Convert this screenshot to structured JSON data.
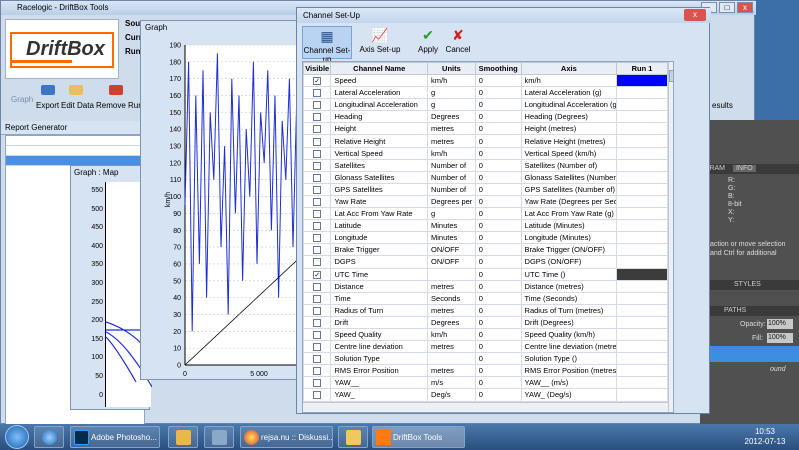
{
  "main_window": {
    "title": "Racelogic - DriftBox Tools",
    "controls": [
      "_",
      "□",
      "x"
    ],
    "logo_text": "DriftBox",
    "ribbon": {
      "graph_label": "Graph",
      "buttons": [
        "Export",
        "Edit Data",
        "Remove Run"
      ]
    },
    "side_labels": [
      "Sour",
      "Curr",
      "Run"
    ],
    "results_label": "esults",
    "report_generator": "Report Generator"
  },
  "map_window": {
    "title": "Graph : Map",
    "y_ticks": [
      "550",
      "500",
      "450",
      "400",
      "350",
      "300",
      "250",
      "200",
      "150",
      "100",
      "50",
      "0"
    ]
  },
  "graph_window": {
    "title": "Graph",
    "y_label": "km/h",
    "x_ticks": [
      "0",
      "5 000"
    ]
  },
  "chart_data": {
    "type": "line",
    "ylabel": "km/h",
    "ylim": [
      0,
      190
    ],
    "y_ticks": [
      0,
      10,
      20,
      30,
      40,
      50,
      60,
      70,
      80,
      90,
      100,
      110,
      120,
      130,
      140,
      150,
      160,
      170,
      180,
      190
    ],
    "x_ticks": [
      0,
      5000
    ],
    "grid": true,
    "series": [
      {
        "color": "#1f2fd6",
        "values": [
          95,
          180,
          20,
          160,
          60,
          175,
          40,
          150,
          110,
          185,
          70,
          130,
          30,
          170,
          90,
          160,
          50,
          140,
          100,
          180,
          60,
          150,
          120,
          175,
          80,
          160,
          40,
          145,
          110,
          170,
          70,
          155,
          95,
          165,
          55,
          140
        ]
      },
      {
        "color": "#111111",
        "values": [
          0,
          2,
          4,
          6,
          8,
          10,
          12,
          14,
          16,
          18,
          20,
          22,
          24,
          26,
          28,
          30,
          32,
          34,
          36,
          38,
          40,
          42,
          44,
          46,
          48,
          50,
          52,
          54,
          56,
          58,
          60,
          62,
          64,
          66,
          68,
          70
        ]
      }
    ]
  },
  "dialog": {
    "title": "Channel Set-Up",
    "close": "x",
    "toolbar": [
      {
        "label": "Channel Set-up",
        "icon": "channel-setup-icon"
      },
      {
        "label": "Axis Set-up",
        "icon": "axis-setup-icon"
      },
      {
        "label": "Apply",
        "icon": "checkmark-icon"
      },
      {
        "label": "Cancel",
        "icon": "cross-icon"
      }
    ],
    "columns": [
      "Visible",
      "Channel Name",
      "Units",
      "Smoothing",
      "Axis",
      "Run 1"
    ],
    "rows": [
      {
        "visible": true,
        "name": "Speed",
        "units": "km/h",
        "smoothing": "0",
        "axis": "km/h",
        "run_color": "#0000ff"
      },
      {
        "visible": false,
        "name": "Lateral Acceleration",
        "units": "g",
        "smoothing": "0",
        "axis": "Lateral Acceleration (g)",
        "run_color": ""
      },
      {
        "visible": false,
        "name": "Longitudinal Acceleration",
        "units": "g",
        "smoothing": "0",
        "axis": "Longitudinal Acceleration (g)",
        "run_color": ""
      },
      {
        "visible": false,
        "name": "Heading",
        "units": "Degrees",
        "smoothing": "0",
        "axis": "Heading (Degrees)",
        "run_color": ""
      },
      {
        "visible": false,
        "name": "Height",
        "units": "metres",
        "smoothing": "0",
        "axis": "Height (metres)",
        "run_color": ""
      },
      {
        "visible": false,
        "name": "Relative Height",
        "units": "metres",
        "smoothing": "0",
        "axis": "Relative Height (metres)",
        "run_color": ""
      },
      {
        "visible": false,
        "name": "Vertical Speed",
        "units": "km/h",
        "smoothing": "0",
        "axis": "Vertical Speed (km/h)",
        "run_color": ""
      },
      {
        "visible": false,
        "name": "Satellites",
        "units": "Number of",
        "smoothing": "0",
        "axis": "Satellites (Number of)",
        "run_color": ""
      },
      {
        "visible": false,
        "name": "Glonass Satellites",
        "units": "Number of",
        "smoothing": "0",
        "axis": "Glonass Satellites (Number of)",
        "run_color": ""
      },
      {
        "visible": false,
        "name": "GPS Satellites",
        "units": "Number of",
        "smoothing": "0",
        "axis": "GPS Satellites (Number of)",
        "run_color": ""
      },
      {
        "visible": false,
        "name": "Yaw Rate",
        "units": "Degrees per Se",
        "smoothing": "0",
        "axis": "Yaw Rate (Degrees per Second)",
        "run_color": ""
      },
      {
        "visible": false,
        "name": "Lat Acc From Yaw Rate",
        "units": "g",
        "smoothing": "0",
        "axis": "Lat Acc From Yaw Rate (g)",
        "run_color": ""
      },
      {
        "visible": false,
        "name": "Latitude",
        "units": "Minutes",
        "smoothing": "0",
        "axis": "Latitude (Minutes)",
        "run_color": ""
      },
      {
        "visible": false,
        "name": "Longitude",
        "units": "Minutes",
        "smoothing": "0",
        "axis": "Longitude (Minutes)",
        "run_color": ""
      },
      {
        "visible": false,
        "name": "Brake Trigger",
        "units": "ON/OFF",
        "smoothing": "0",
        "axis": "Brake Trigger (ON/OFF)",
        "run_color": ""
      },
      {
        "visible": false,
        "name": "DGPS",
        "units": "ON/OFF",
        "smoothing": "0",
        "axis": "DGPS (ON/OFF)",
        "run_color": ""
      },
      {
        "visible": true,
        "name": "UTC Time",
        "units": "",
        "smoothing": "0",
        "axis": "UTC Time ()",
        "run_color": "#3c3c3c"
      },
      {
        "visible": false,
        "name": "Distance",
        "units": "metres",
        "smoothing": "0",
        "axis": "Distance (metres)",
        "run_color": ""
      },
      {
        "visible": false,
        "name": "Time",
        "units": "Seconds",
        "smoothing": "0",
        "axis": "Time (Seconds)",
        "run_color": ""
      },
      {
        "visible": false,
        "name": "Radius of Turn",
        "units": "metres",
        "smoothing": "0",
        "axis": "Radius of Turn (metres)",
        "run_color": ""
      },
      {
        "visible": false,
        "name": "Drift",
        "units": "Degrees",
        "smoothing": "0",
        "axis": "Drift (Degrees)",
        "run_color": ""
      },
      {
        "visible": false,
        "name": "Speed Quality",
        "units": "km/h",
        "smoothing": "0",
        "axis": "Speed Quality (km/h)",
        "run_color": ""
      },
      {
        "visible": false,
        "name": "Centre line deviation",
        "units": "metres",
        "smoothing": "0",
        "axis": "Centre line deviation (metres)",
        "run_color": ""
      },
      {
        "visible": false,
        "name": "Solution Type",
        "units": "",
        "smoothing": "0",
        "axis": "Solution Type ()",
        "run_color": ""
      },
      {
        "visible": false,
        "name": "RMS Error Position",
        "units": "metres",
        "smoothing": "0",
        "axis": "RMS Error Position (metres)",
        "run_color": ""
      },
      {
        "visible": false,
        "name": "YAW__",
        "units": "m/s",
        "smoothing": "0",
        "axis": "YAW__ (m/s)",
        "run_color": ""
      },
      {
        "visible": false,
        "name": "YAW_",
        "units": "Deg/s",
        "smoothing": "0",
        "axis": "YAW_ (Deg/s)",
        "run_color": ""
      },
      {
        "visible": false,
        "name": "",
        "units": "",
        "smoothing": "",
        "axis": "",
        "run_color": ""
      }
    ]
  },
  "photoshop_panel": {
    "tabs": [
      "GRAM",
      "INFO"
    ],
    "info_lines": [
      "R:",
      "G:",
      "B:",
      "8-bit",
      "X:",
      "Y:"
    ],
    "help_text": [
      "action or move selection",
      "and Ctrl for additional"
    ],
    "styles": "STYLES",
    "paths": "PATHS",
    "opacity_label": "Opacity:",
    "opacity_value": "100%",
    "fill_label": "Fill:",
    "fill_value": "100%",
    "layer_label": "ound"
  },
  "taskbar": {
    "items": [
      "Adobe Photosho...",
      "",
      "",
      "rejsa.nu :: Diskussi...",
      "",
      "DriftBox Tools"
    ],
    "time": "10:53",
    "date": "2012-07-13"
  }
}
